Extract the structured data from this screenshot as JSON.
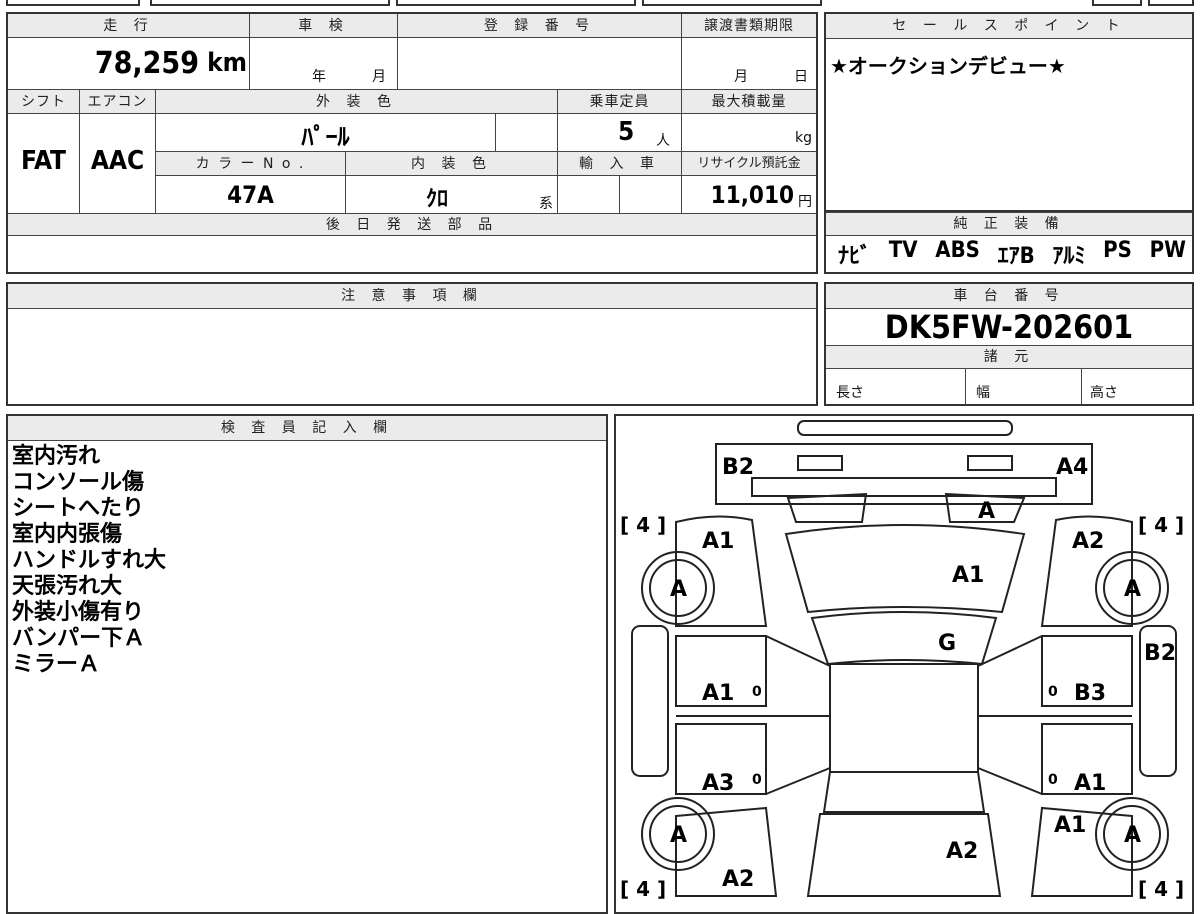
{
  "top_form": {
    "mileage_label": "走 行",
    "mileage_value": "78,259",
    "mileage_unit": "km",
    "inspection_label": "車 検",
    "inspection_year": "年",
    "inspection_month": "月",
    "registration_label": "登 録 番 号",
    "transfer_label": "譲渡書類期限",
    "transfer_month": "月",
    "transfer_day": "日",
    "shift_label": "シフト",
    "shift_value": "FAT",
    "ac_label": "エアコン",
    "ac_value": "AAC",
    "exterior_label": "外 装 色",
    "exterior_value": "ﾊﾟｰﾙ",
    "capacity_label": "乗車定員",
    "capacity_value": "5",
    "capacity_unit": "人",
    "load_label": "最大積載量",
    "load_unit": "kg",
    "color_no_label": "カ ラ ー N o .",
    "color_no_value": "47A",
    "interior_label": "内 装 色",
    "interior_value": "ｸﾛ",
    "interior_unit": "系",
    "import_label": "輸 入 車",
    "recycle_label": "リサイクル預託金",
    "recycle_value": "11,010",
    "recycle_unit": "円",
    "later_parts_label": "後 日 発 送 部 品"
  },
  "sales_point": {
    "label": "セ ー ル ス ポ イ ン ト",
    "text": "★オークションデビュー★"
  },
  "equipment": {
    "label": "純 正 装 備",
    "items": [
      "ﾅﾋﾞ",
      "TV",
      "ABS",
      "ｴｱB",
      "ｱﾙﾐ",
      "PS",
      "PW"
    ]
  },
  "notes": {
    "label": "注 意 事 項 欄"
  },
  "chassis": {
    "label": "車 台 番 号",
    "value": "DK5FW-202601",
    "spec_label": "諸 元",
    "length_label": "長さ",
    "width_label": "幅",
    "height_label": "高さ"
  },
  "inspector": {
    "label": "検 査 員 記 入 欄",
    "remarks": [
      "室内汚れ",
      "コンソール傷",
      "シートへたり",
      "室内内張傷",
      "ハンドルすれ大",
      "天張汚れ大",
      "外装小傷有り",
      "バンパー下Ａ",
      "ミラーＡ"
    ]
  },
  "diagram": {
    "labels": {
      "b2_top": "B2",
      "a4_top": "A4",
      "a_windshield": "A",
      "a1_left_front": "A1",
      "a2_right_front": "A2",
      "a1_hood": "A1",
      "g_windshield": "G",
      "b2_right": "B2",
      "a1_left_door": "A1",
      "b3_right_door": "B3",
      "a3_left_rear_door": "A3",
      "a1_right_rear_door": "A1",
      "a1_right_rear": "A1",
      "a2_trunk": "A2",
      "a2_left_rear": "A2",
      "tire_fl": "A",
      "tire_fr": "A",
      "tire_rl": "A",
      "tire_rr": "A",
      "tread_fl": "[ 4 ]",
      "tread_fr": "[ 4 ]",
      "tread_rl": "[ 4 ]",
      "tread_rr": "[ 4 ]",
      "zero_1": "0",
      "zero_2": "0",
      "zero_3": "0",
      "zero_4": "0"
    }
  }
}
